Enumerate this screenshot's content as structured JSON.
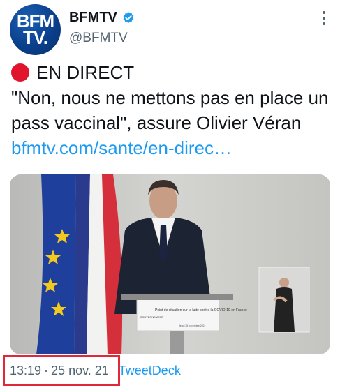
{
  "account": {
    "avatar_line1": "BFM",
    "avatar_line2": "TV.",
    "name": "BFMTV",
    "handle": "@BFMTV"
  },
  "tweet": {
    "live_label": "EN DIRECT",
    "text": "\"Non, nous ne mettons pas en place un pass vaccinal\", assure Olivier Véran",
    "link": "bfmtv.com/sante/en-direc…"
  },
  "media": {
    "podium_text": "Point de situation sur la lutte contre la COVID-19 en France",
    "podium_logo": "GOUVERNEMENT",
    "podium_date": "Jeudi 25 novembre 2021"
  },
  "meta": {
    "time": "13:19",
    "separator": "·",
    "date": "25 nov. 21",
    "source": "TweetDeck"
  },
  "colors": {
    "link": "#1d9bf0",
    "live_dot": "#e0142c",
    "highlight_box": "#e0283a",
    "avatar_bg": "#0b3f8c"
  }
}
